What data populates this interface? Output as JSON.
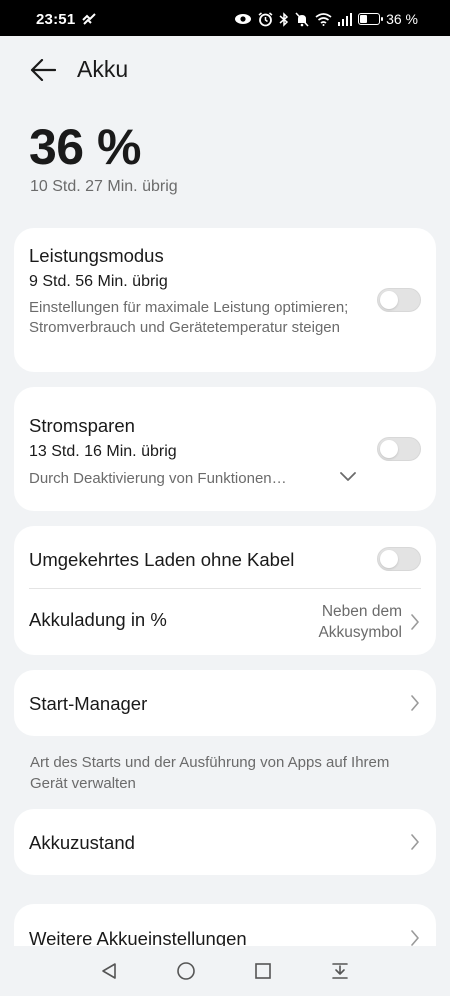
{
  "status_bar": {
    "time": "23:51",
    "battery_text": "36 %",
    "battery_level": 0.36,
    "icons": [
      "notification-icon",
      "eye-comfort-icon",
      "alarm-icon",
      "bluetooth-icon",
      "mute-icon",
      "wifi-icon",
      "signal-icon",
      "battery-icon"
    ]
  },
  "header": {
    "back_icon": "arrow-left-icon",
    "title": "Akku"
  },
  "battery": {
    "percent": "36 %",
    "remaining": "10 Std. 27 Min. übrig"
  },
  "performance": {
    "title": "Leistungsmodus",
    "remaining": "9 Std. 56 Min. übrig",
    "description": "Einstellungen für maximale Leistung optimieren; Stromverbrauch und Gerätetemperatur steigen",
    "enabled": false
  },
  "power_saving": {
    "title": "Stromsparen",
    "remaining": "13 Std. 16 Min. übrig",
    "description": "Durch Deaktivierung von Funktionen…",
    "enabled": false
  },
  "reverse_charging": {
    "title": "Umgekehrtes Laden ohne Kabel",
    "enabled": false
  },
  "battery_percentage": {
    "title": "Akkuladung in %",
    "value_line1": "Neben dem",
    "value_line2": "Akkusymbol"
  },
  "start_manager": {
    "title": "Start-Manager",
    "hint": "Art des Starts und der Ausführung von Apps auf Ihrem Gerät verwalten"
  },
  "battery_health": {
    "title": "Akkuzustand"
  },
  "more_settings": {
    "title": "Weitere Akkueinstellungen"
  },
  "navigation": {
    "icons": [
      "back-triangle-icon",
      "home-circle-icon",
      "recents-square-icon",
      "notification-pull-icon"
    ]
  }
}
